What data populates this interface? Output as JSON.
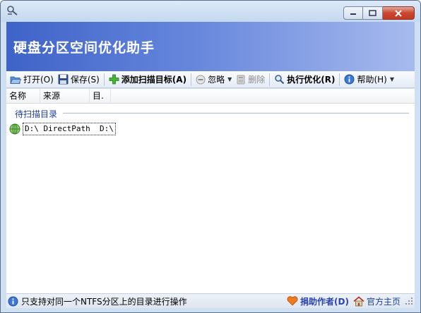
{
  "window": {
    "title": "硬盘分区空间优化助手",
    "colors": {
      "banner_start": "#3e63c8",
      "banner_end": "#a8bbef",
      "close_button": "#c9462f"
    }
  },
  "toolbar": {
    "items": [
      {
        "label": "打开(O)",
        "icon": "folder-open-icon"
      },
      {
        "label": "保存(S)",
        "icon": "save-disk-icon"
      },
      {
        "label": "添加扫描目标(A)",
        "icon": "add-plus-icon"
      },
      {
        "label": "忽略",
        "icon": "ignore-icon"
      },
      {
        "label": "删除",
        "icon": "delete-icon"
      },
      {
        "label": "执行优化(R)",
        "icon": "magnifier-icon"
      },
      {
        "label": "帮助(H)",
        "icon": "info-icon"
      }
    ]
  },
  "list": {
    "columns": [
      "名称",
      "来源",
      "目."
    ],
    "group_label": "待扫描目录",
    "rows": [
      {
        "text": "D:\\ DirectPath  D:\\",
        "icon": "globe-icon"
      }
    ]
  },
  "status": {
    "message": "只支持对同一个NTFS分区上的目录进行操作",
    "donate_label": "捐助作者(D)",
    "homepage_label": "官方主页"
  }
}
